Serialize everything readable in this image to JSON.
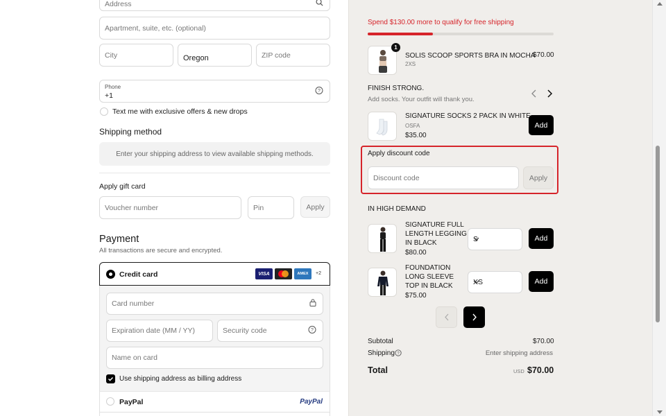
{
  "address_form": {
    "address_placeholder": "Address",
    "apartment_placeholder": "Apartment, suite, etc. (optional)",
    "city_placeholder": "City",
    "state_value": "Oregon",
    "zip_placeholder": "ZIP code",
    "phone_label": "Phone",
    "phone_value": "+1",
    "sms_optin_label": "Text me with exclusive offers & new drops"
  },
  "shipping": {
    "title": "Shipping method",
    "notice": "Enter your shipping address to view available shipping methods."
  },
  "gift_card": {
    "title": "Apply gift card",
    "voucher_placeholder": "Voucher number",
    "pin_placeholder": "Pin",
    "apply_label": "Apply"
  },
  "payment": {
    "title": "Payment",
    "subtitle": "All transactions are secure and encrypted.",
    "credit_card_label": "Credit card",
    "more_cards": "+2",
    "card_brands": [
      "VISA",
      "AMEX"
    ],
    "card_number_placeholder": "Card number",
    "expiry_placeholder": "Expiration date (MM / YY)",
    "security_placeholder": "Security code",
    "name_placeholder": "Name on card",
    "billing_checkbox_label": "Use shipping address as billing address",
    "paypal_label": "PayPal",
    "paypal_logo": "PayPal"
  },
  "summary": {
    "free_shipping_msg": "Spend $130.00 more to qualify for free shipping",
    "free_shipping_progress": 0.35,
    "accent_color": "#d6242a",
    "cart_item": {
      "qty_badge": "1",
      "name": "SOLIS SCOOP SPORTS BRA IN MOCHA",
      "variant": "2XS",
      "price": "$70.00"
    },
    "upsell": {
      "title": "FINISH STRONG.",
      "subtitle": "Add socks. Your outfit will thank you.",
      "product_name": "SIGNATURE SOCKS 2 PACK IN WHITE",
      "variant": "OSFA",
      "price": "$35.00",
      "add_label": "Add"
    },
    "discount": {
      "title": "Apply discount code",
      "placeholder": "Discount code",
      "apply_label": "Apply"
    },
    "demand": {
      "title": "IN HIGH DEMAND",
      "items": [
        {
          "name": "SIGNATURE FULL LENGTH LEGGING IN BLACK",
          "price": "$80.00",
          "size": "S",
          "add_label": "Add"
        },
        {
          "name": "FOUNDATION LONG SLEEVE TOP IN BLACK",
          "price": "$75.00",
          "size": "XS",
          "add_label": "Add"
        }
      ]
    },
    "totals": {
      "subtotal_label": "Subtotal",
      "subtotal_value": "$70.00",
      "shipping_label": "Shipping",
      "shipping_value": "Enter shipping address",
      "total_label": "Total",
      "currency": "USD",
      "total_value": "$70.00"
    }
  }
}
